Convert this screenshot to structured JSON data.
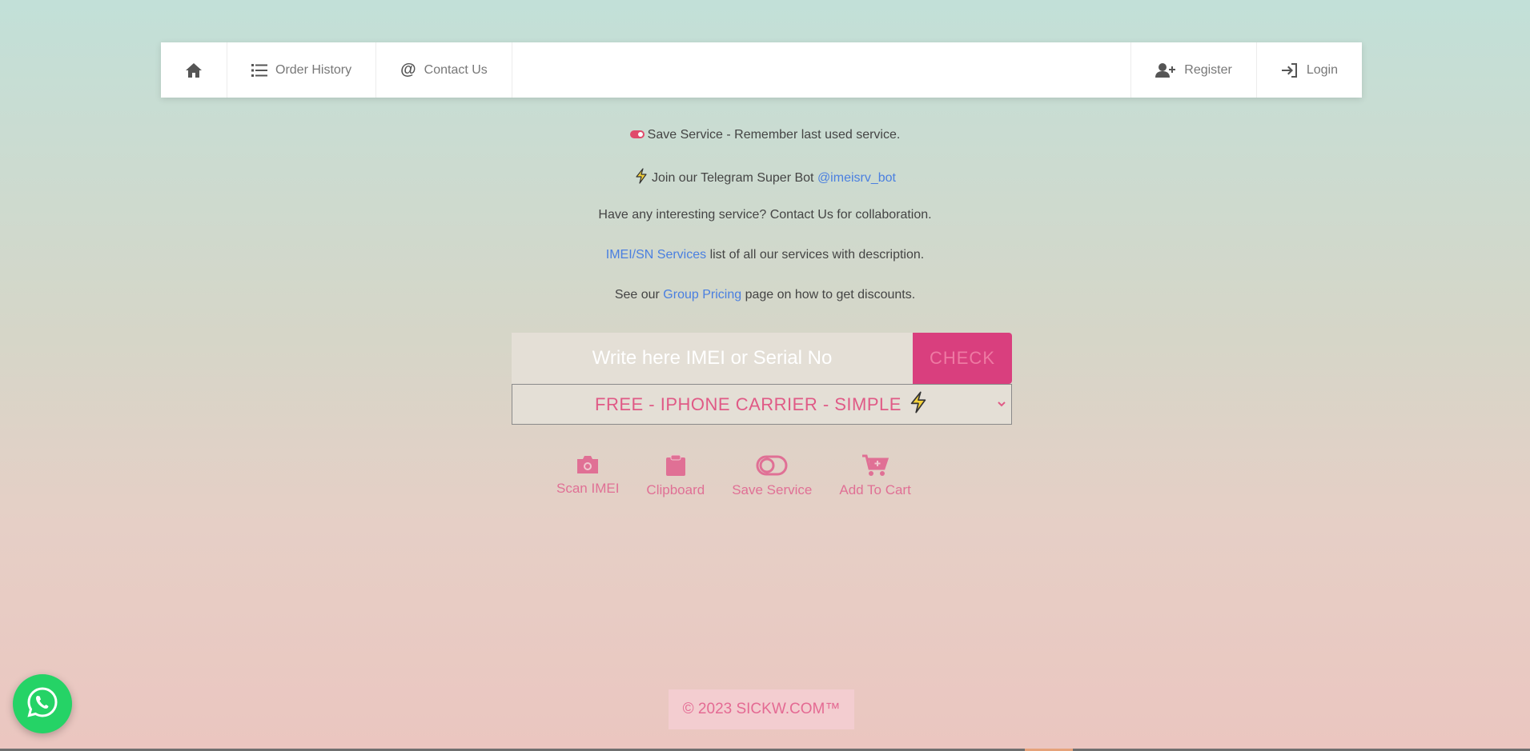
{
  "nav": {
    "home_icon": "home-icon",
    "order_history": "Order History",
    "contact_us": "Contact Us",
    "register": "Register",
    "login": "Login"
  },
  "info": {
    "save_service_text": "Save Service - Remember last used service.",
    "telegram_prefix": "Join our Telegram Super Bot ",
    "telegram_link": "@imeisrv_bot",
    "collab": "Have any interesting service? Contact Us for collaboration.",
    "services_link": "IMEI/SN Services",
    "services_suffix": " list of all our services with description.",
    "pricing_prefix": "See our ",
    "pricing_link": "Group Pricing",
    "pricing_suffix": " page on how to get discounts."
  },
  "search": {
    "placeholder": "Write here IMEI or Serial No",
    "check_label": "CHECK"
  },
  "service_select": {
    "selected": "FREE - IPHONE CARRIER - SIMPLE"
  },
  "actions": [
    {
      "label": "Scan IMEI",
      "icon": "camera-icon"
    },
    {
      "label": "Clipboard",
      "icon": "clipboard-icon"
    },
    {
      "label": "Save Service",
      "icon": "toggle-icon"
    },
    {
      "label": "Add To Cart",
      "icon": "cart-plus-icon"
    }
  ],
  "footer": {
    "copyright": "© 2023 SICKW.COM™"
  },
  "colors": {
    "accent": "#d93f7e",
    "link": "#4a7fe0",
    "whatsapp": "#25d366"
  }
}
